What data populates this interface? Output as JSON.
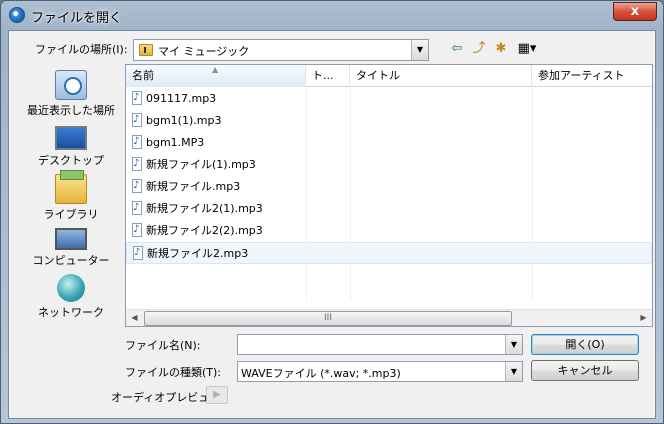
{
  "window": {
    "title": "ファイルを開く",
    "close_label": "x"
  },
  "lookin": {
    "label": "ファイルの場所(I):",
    "value": "マイ ミュージック"
  },
  "toolbar": {
    "back_glyph": "⇦",
    "up_glyph": "⤴",
    "newfolder_glyph": "✱",
    "views_glyph": "▦▾"
  },
  "places": [
    {
      "label": "最近表示した場所",
      "icon": "recent-places-icon"
    },
    {
      "label": "デスクトップ",
      "icon": "desktop-icon"
    },
    {
      "label": "ライブラリ",
      "icon": "libraries-icon"
    },
    {
      "label": "コンピューター",
      "icon": "computer-icon"
    },
    {
      "label": "ネットワーク",
      "icon": "network-icon"
    }
  ],
  "columns": {
    "name": "名前",
    "type": "ト...",
    "title": "タイトル",
    "artist": "参加アーティスト"
  },
  "files": [
    "091117.mp3",
    "bgm1(1).mp3",
    "bgm1.MP3",
    "新規ファイル(1).mp3",
    "新規ファイル.mp3",
    "新規ファイル2(1).mp3",
    "新規ファイル2(2).mp3",
    "新規ファイル2.mp3"
  ],
  "filename": {
    "label": "ファイル名(N):",
    "value": ""
  },
  "filetype": {
    "label": "ファイルの種類(T):",
    "value": "WAVEファイル (*.wav; *.mp3)"
  },
  "buttons": {
    "open": "開く(O)",
    "cancel": "キャンセル"
  },
  "preview": {
    "label": "オーディオプレビュー:"
  },
  "scroll": {
    "thumb_grip": "III",
    "left": "◀",
    "right": "▶"
  }
}
